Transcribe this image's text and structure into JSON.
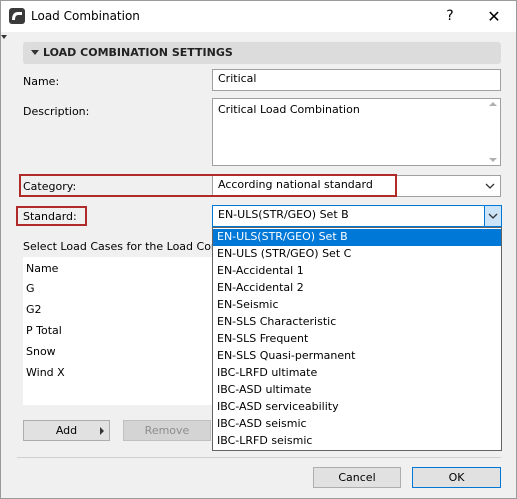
{
  "window": {
    "title": "Load Combination",
    "help_label": "?",
    "close_label": "✕"
  },
  "section": {
    "title": "LOAD COMBINATION SETTINGS"
  },
  "fields": {
    "name_label": "Name:",
    "name_value": "Critical",
    "description_label": "Description:",
    "description_value": "Critical Load Combination",
    "category_label": "Category:",
    "category_value": "According national standard",
    "standard_label": "Standard:",
    "standard_value": "EN-ULS(STR/GEO) Set B"
  },
  "load_cases": {
    "label": "Select Load Cases for the Load Combi",
    "items": [
      "Name",
      "G",
      "G2",
      "P Total",
      "Snow",
      "Wind X"
    ]
  },
  "dropdown": {
    "options": [
      "EN-ULS(STR/GEO) Set B",
      "EN-ULS (STR/GEO) Set C",
      "EN-Accidental 1",
      "EN-Accidental 2",
      "EN-Seismic",
      "EN-SLS Characteristic",
      "EN-SLS Frequent",
      "EN-SLS Quasi-permanent",
      "IBC-LRFD ultimate",
      "IBC-ASD ultimate",
      "IBC-ASD serviceability",
      "IBC-ASD seismic",
      "IBC-LRFD seismic"
    ],
    "selected_index": 0
  },
  "buttons": {
    "add": "Add",
    "remove": "Remove",
    "cancel": "Cancel",
    "ok": "OK"
  },
  "colors": {
    "highlight": "#0078d7",
    "annotation_red": "#b02a2a"
  }
}
